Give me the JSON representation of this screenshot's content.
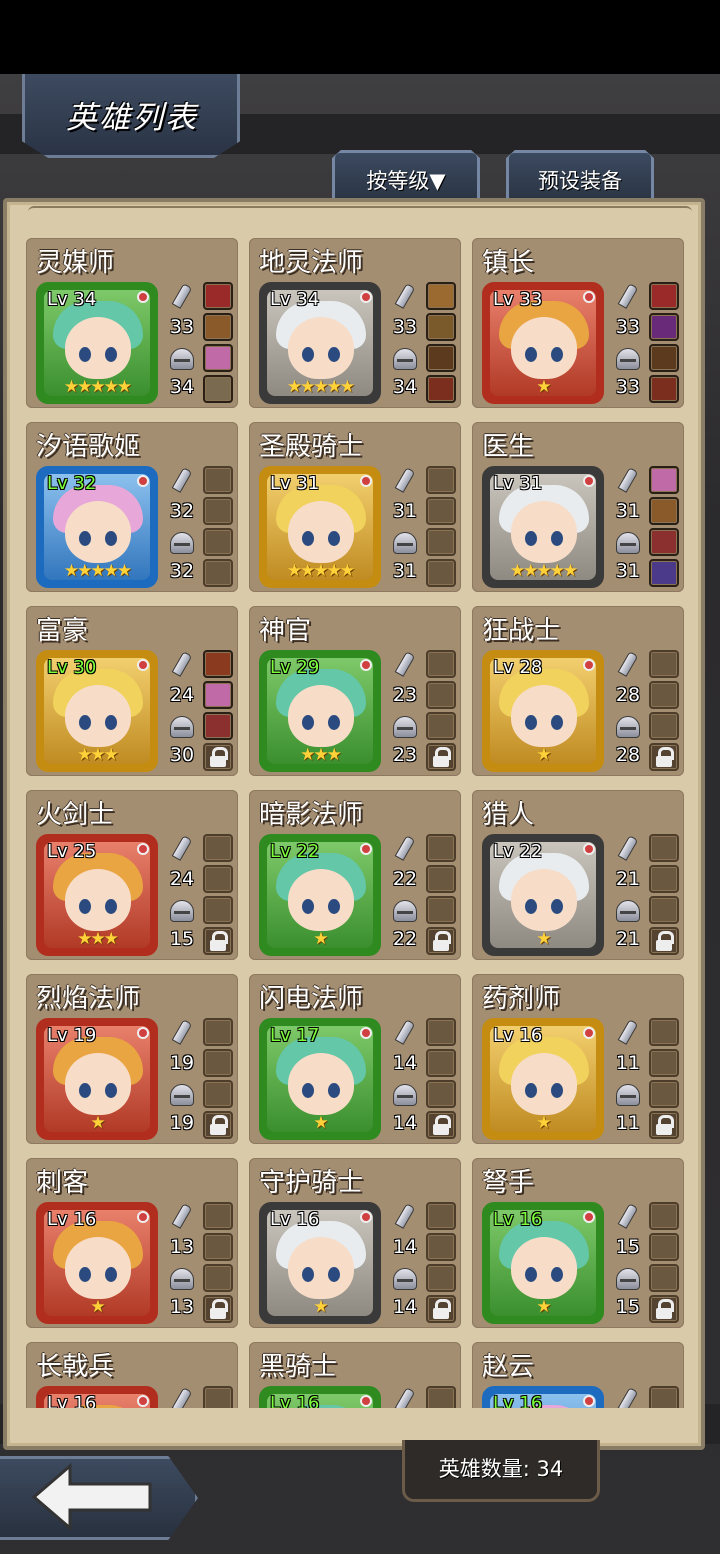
{
  "header": {
    "title": "英雄列表",
    "sort_label": "按等级▼",
    "preset_label": "预设装备"
  },
  "footer": {
    "hero_count_label": "英雄数量: 34"
  },
  "colors": {
    "panel": "#d9cba9",
    "card": "#a48e72",
    "star": "#ffd23a",
    "level_green": "#7cff3a"
  },
  "heroes": [
    {
      "name": "灵媒师",
      "level": "Lv 34",
      "atk": "33",
      "def": "34",
      "stars": "★★★★★",
      "frame": "green",
      "equip": [
        "amulet",
        "box",
        "potion",
        "scroll"
      ]
    },
    {
      "name": "地灵法师",
      "level": "Lv 34",
      "atk": "33",
      "def": "34",
      "stars": "★★★★★",
      "frame": "gray",
      "equip": [
        "chest",
        "staff",
        "bow",
        "axe"
      ]
    },
    {
      "name": "镇长",
      "level": "Lv 33",
      "atk": "33",
      "def": "33",
      "stars": "★",
      "frame": "red",
      "equip": [
        "amulet",
        "hat",
        "bow",
        "axe"
      ]
    },
    {
      "name": "汐语歌姬",
      "level": "Lv 32",
      "atk": "32",
      "def": "32",
      "stars": "★★★★★",
      "frame": "blue",
      "equip": [
        "",
        "",
        "",
        ""
      ]
    },
    {
      "name": "圣殿骑士",
      "level": "Lv 31",
      "atk": "31",
      "def": "31",
      "stars": "★★★★★",
      "frame": "gold",
      "equip": [
        "",
        "",
        "",
        ""
      ]
    },
    {
      "name": "医生",
      "level": "Lv 31",
      "atk": "31",
      "def": "31",
      "stars": "★★★★★",
      "frame": "gray",
      "equip": [
        "potion",
        "box",
        "ring",
        "bag"
      ]
    },
    {
      "name": "富豪",
      "level": "Lv 30",
      "atk": "24",
      "def": "30",
      "stars": "★★★",
      "frame": "gold",
      "equip": [
        "armor",
        "potion",
        "ring",
        "lock"
      ]
    },
    {
      "name": "神官",
      "level": "Lv 29",
      "atk": "23",
      "def": "23",
      "stars": "★★★",
      "frame": "green",
      "equip": [
        "",
        "",
        "",
        "lock"
      ]
    },
    {
      "name": "狂战士",
      "level": "Lv 28",
      "atk": "28",
      "def": "28",
      "stars": "★",
      "frame": "gold",
      "equip": [
        "",
        "",
        "",
        "lock"
      ]
    },
    {
      "name": "火剑士",
      "level": "Lv 25",
      "atk": "24",
      "def": "15",
      "stars": "★★★",
      "frame": "red",
      "equip": [
        "",
        "",
        "",
        "lock"
      ]
    },
    {
      "name": "暗影法师",
      "level": "Lv 22",
      "atk": "22",
      "def": "22",
      "stars": "★",
      "frame": "green",
      "equip": [
        "",
        "",
        "",
        "lock"
      ]
    },
    {
      "name": "猎人",
      "level": "Lv 22",
      "atk": "21",
      "def": "21",
      "stars": "★",
      "frame": "gray",
      "equip": [
        "",
        "",
        "",
        "lock"
      ]
    },
    {
      "name": "烈焰法师",
      "level": "Lv 19",
      "atk": "19",
      "def": "19",
      "stars": "★",
      "frame": "red",
      "equip": [
        "",
        "",
        "",
        "lock"
      ]
    },
    {
      "name": "闪电法师",
      "level": "Lv 17",
      "atk": "14",
      "def": "14",
      "stars": "★",
      "frame": "green",
      "equip": [
        "",
        "",
        "",
        "lock"
      ]
    },
    {
      "name": "药剂师",
      "level": "Lv 16",
      "atk": "11",
      "def": "11",
      "stars": "★",
      "frame": "gold",
      "equip": [
        "",
        "",
        "",
        "lock"
      ]
    },
    {
      "name": "刺客",
      "level": "Lv 16",
      "atk": "13",
      "def": "13",
      "stars": "★",
      "frame": "red",
      "equip": [
        "",
        "",
        "",
        "lock"
      ]
    },
    {
      "name": "守护骑士",
      "level": "Lv 16",
      "atk": "14",
      "def": "14",
      "stars": "★",
      "frame": "gray",
      "equip": [
        "",
        "",
        "",
        "lock"
      ]
    },
    {
      "name": "弩手",
      "level": "Lv 16",
      "atk": "15",
      "def": "15",
      "stars": "★",
      "frame": "green",
      "equip": [
        "",
        "",
        "",
        "lock"
      ]
    },
    {
      "name": "长戟兵",
      "level": "Lv 16",
      "atk": "",
      "def": "",
      "stars": "",
      "frame": "red",
      "equip": [
        "",
        "",
        "",
        ""
      ]
    },
    {
      "name": "黑骑士",
      "level": "Lv 16",
      "atk": "",
      "def": "",
      "stars": "",
      "frame": "green",
      "equip": [
        "",
        "",
        "",
        ""
      ]
    },
    {
      "name": "赵云",
      "level": "Lv 16",
      "atk": "",
      "def": "",
      "stars": "",
      "frame": "blue",
      "equip": [
        "",
        "",
        "",
        ""
      ]
    }
  ]
}
